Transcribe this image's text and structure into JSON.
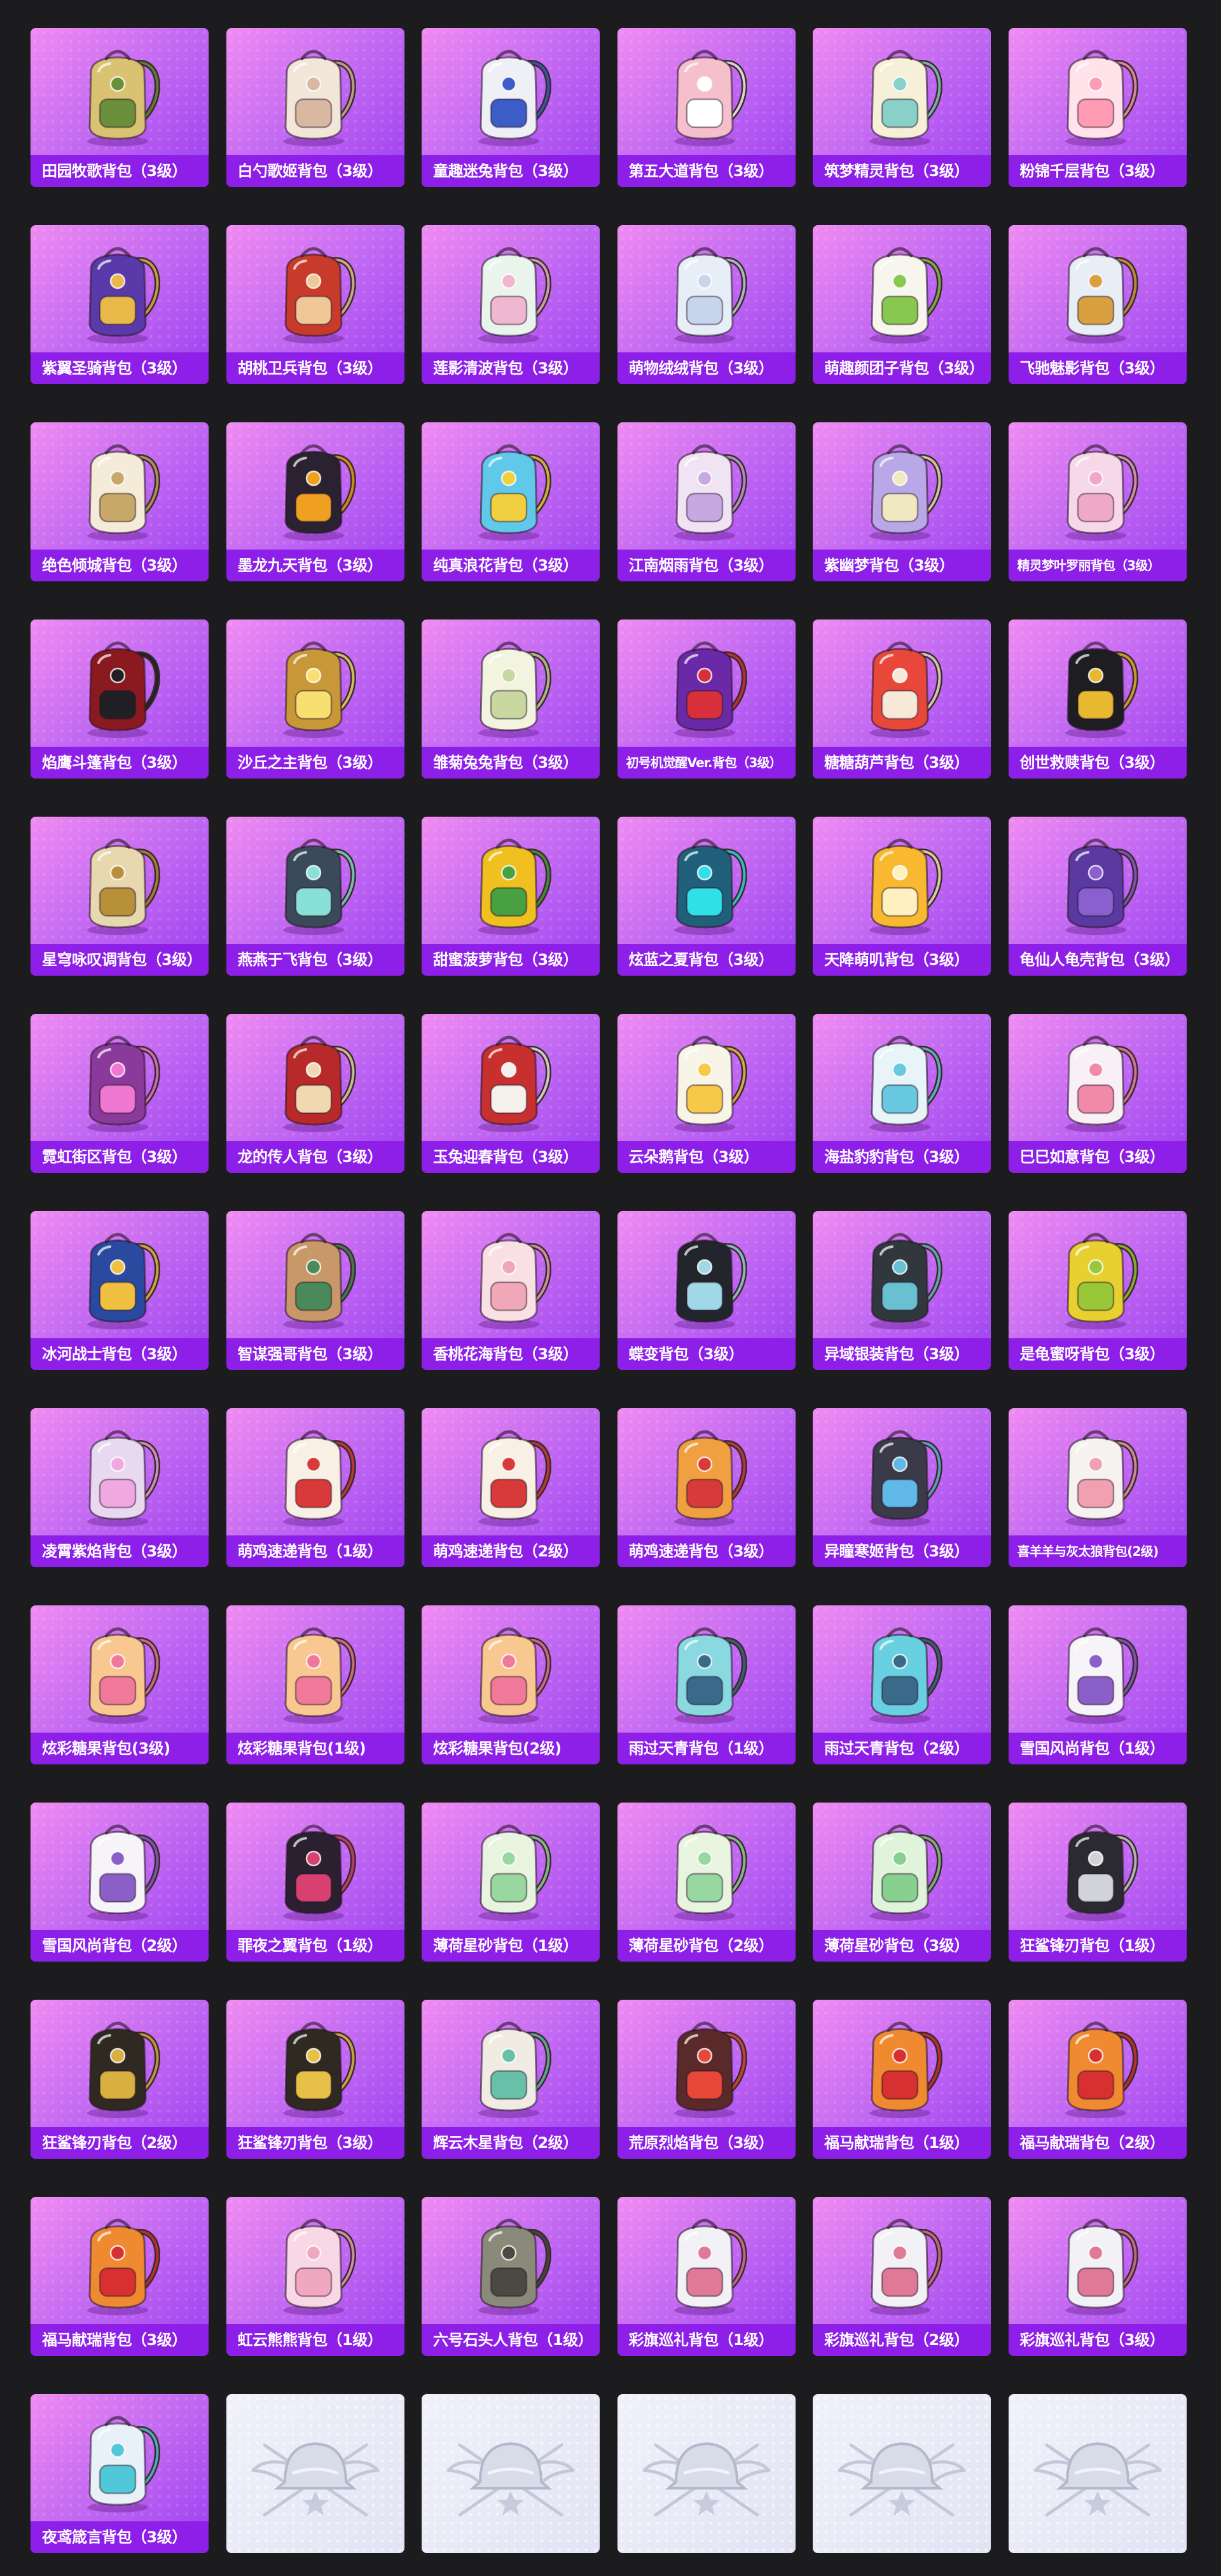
{
  "items": [
    {
      "label": "田园牧歌背包（3级）",
      "icon": "woven-basket-backpack",
      "color": "#d9c271",
      "accent": "#6a8f3a"
    },
    {
      "label": "白勺歌姬背包（3级）",
      "icon": "cream-plush-backpack",
      "color": "#f2e6d8",
      "accent": "#d8b8a0"
    },
    {
      "label": "童趣迷兔背包（3级）",
      "icon": "bunny-patchwork-backpack",
      "color": "#eef0f6",
      "accent": "#3c5cc8"
    },
    {
      "label": "第五大道背包（3级）",
      "icon": "pink-leather-backpack",
      "color": "#f5c0cc",
      "accent": "#ffffff"
    },
    {
      "label": "筑梦精灵背包（3级）",
      "icon": "fairy-winged-backpack",
      "color": "#f6f0d8",
      "accent": "#88d0c8"
    },
    {
      "label": "粉锦千层背包（3级）",
      "icon": "pink-ruffle-backpack",
      "color": "#ffe2ea",
      "accent": "#ff9cb4"
    },
    {
      "label": "紫翼圣骑背包（3级）",
      "icon": "armored-knight-backpack",
      "color": "#5a3aa8",
      "accent": "#e8b848"
    },
    {
      "label": "胡桃卫兵背包（3级）",
      "icon": "nutcracker-backpack",
      "color": "#c83a2a",
      "accent": "#f0c898"
    },
    {
      "label": "莲影清波背包（3级）",
      "icon": "lotus-backpack",
      "color": "#e8f4ec",
      "accent": "#f0b8d0"
    },
    {
      "label": "萌物绒绒背包（3级）",
      "icon": "fluffy-plush-backpack",
      "color": "#e8eef8",
      "accent": "#c8d4ec"
    },
    {
      "label": "萌趣颜团子背包（3级）",
      "icon": "dumpling-mascot-backpack",
      "color": "#f6f6ee",
      "accent": "#88c850"
    },
    {
      "label": "飞驰魅影背包（3级）",
      "icon": "racer-backpack",
      "color": "#e8eef6",
      "accent": "#d8a040"
    },
    {
      "label": "绝色倾城背包（3级）",
      "icon": "round-ornate-backpack",
      "color": "#f4ecd8",
      "accent": "#c8a868"
    },
    {
      "label": "墨龙九天背包（3级）",
      "icon": "black-dragon-backpack",
      "color": "#2a2230",
      "accent": "#f0a020"
    },
    {
      "label": "纯真浪花背包（3级）",
      "icon": "drink-cup-backpack",
      "color": "#60c8e8",
      "accent": "#f0d040"
    },
    {
      "label": "江南烟雨背包（3级）",
      "icon": "flower-bloom-backpack",
      "color": "#f0e4f4",
      "accent": "#c8a8e0"
    },
    {
      "label": "紫幽梦背包（3级）",
      "icon": "purple-petal-backpack",
      "color": "#b8a8e8",
      "accent": "#f0e8c0"
    },
    {
      "label": "精灵梦叶罗丽背包（3级）",
      "icon": "heart-fairy-backpack",
      "color": "#f6d8e8",
      "accent": "#f0a8c8"
    },
    {
      "label": "焰鹰斗篷背包（3级）",
      "icon": "red-black-tactical-backpack",
      "color": "#8a1a20",
      "accent": "#202024"
    },
    {
      "label": "沙丘之主背包（3级）",
      "icon": "golden-scroll-backpack",
      "color": "#c89838",
      "accent": "#f8e070"
    },
    {
      "label": "雏菊兔兔背包（3级）",
      "icon": "daisy-bunny-backpack",
      "color": "#f2f4e0",
      "accent": "#c8d8a0"
    },
    {
      "label": "初号机觉醒Ver.背包（3级）",
      "icon": "purple-shield-backpack",
      "color": "#6a2aa8",
      "accent": "#d8303a"
    },
    {
      "label": "糖糖葫芦背包（3级）",
      "icon": "candied-haw-backpack",
      "color": "#e8483a",
      "accent": "#f8e8d8"
    },
    {
      "label": "创世救赎背包（3级）",
      "icon": "black-gold-armor-backpack",
      "color": "#1e1e22",
      "accent": "#e8b830"
    },
    {
      "label": "星穹咏叹调背包（3级）",
      "icon": "gold-bunny-ear-backpack",
      "color": "#e8d8b0",
      "accent": "#b8903a"
    },
    {
      "label": "燕燕于飞背包（3级）",
      "icon": "swallow-ornament-backpack",
      "color": "#3a4a5a",
      "accent": "#88e0d8"
    },
    {
      "label": "甜蜜菠萝背包（3级）",
      "icon": "pineapple-backpack",
      "color": "#f0c020",
      "accent": "#48a040"
    },
    {
      "label": "炫蓝之夏背包（3级）",
      "icon": "teal-camo-backpack",
      "color": "#20607a",
      "accent": "#30e0e8"
    },
    {
      "label": "天降萌叽背包（3级）",
      "icon": "yellow-bear-backpack",
      "color": "#f8b830",
      "accent": "#fff0c0"
    },
    {
      "label": "龟仙人龟壳背包（3级）",
      "icon": "turtle-shell-backpack",
      "color": "#5a3aa0",
      "accent": "#8a60d0"
    },
    {
      "label": "霓虹街区背包（3级）",
      "icon": "neon-sequin-backpack",
      "color": "#8a3a9a",
      "accent": "#f078d0"
    },
    {
      "label": "龙的传人背包（3级）",
      "icon": "red-dragon-pack",
      "color": "#b82a2a",
      "accent": "#f0d8b0"
    },
    {
      "label": "玉兔迎春背包（3级）",
      "icon": "red-white-hiking-backpack",
      "color": "#c83030",
      "accent": "#f4f0ec"
    },
    {
      "label": "云朵鹅背包（3级）",
      "icon": "cloud-goose-backpack",
      "color": "#f8f4e8",
      "accent": "#f8c848"
    },
    {
      "label": "海盐豹豹背包（3级）",
      "icon": "sea-salt-leopard-backpack",
      "color": "#e8f4f8",
      "accent": "#68c8e0"
    },
    {
      "label": "巳巳如意背包（3级）",
      "icon": "snake-bun-backpack",
      "color": "#f8f0f4",
      "accent": "#f08aa8"
    },
    {
      "label": "冰河战士背包（3级）",
      "icon": "navy-blue-backpack",
      "color": "#2a4aa0",
      "accent": "#f0c040"
    },
    {
      "label": "智谋强哥背包（3级）",
      "icon": "bear-mascot-backpack",
      "color": "#c89868",
      "accent": "#4a8a5a"
    },
    {
      "label": "香桃花海背包（3级）",
      "icon": "peach-blossom-backpack",
      "color": "#f8e0e4",
      "accent": "#f0a8b8"
    },
    {
      "label": "蝶变背包（3级）",
      "icon": "butterfly-black-backpack",
      "color": "#22262c",
      "accent": "#a0d8e8"
    },
    {
      "label": "异域银装背包（3级）",
      "icon": "silver-mech-backpack",
      "color": "#30383e",
      "accent": "#68c0d0"
    },
    {
      "label": "是龟蜜呀背包（3级）",
      "icon": "yellow-turtle-backpack",
      "color": "#e8d030",
      "accent": "#98c838"
    },
    {
      "label": "凌霄紫焰背包（3级）",
      "icon": "violet-flame-backpack",
      "color": "#e8d8f0",
      "accent": "#f0a8e0"
    },
    {
      "label": "萌鸡速递背包（1级）",
      "icon": "chick-delivery-backpack",
      "color": "#f8f0e4",
      "accent": "#d83a3a"
    },
    {
      "label": "萌鸡速递背包（2级）",
      "icon": "chick-delivery-backpack",
      "color": "#f8f0e4",
      "accent": "#d83a3a"
    },
    {
      "label": "萌鸡速递背包（3级）",
      "icon": "chick-delivery-backpack",
      "color": "#f0a040",
      "accent": "#d83a3a"
    },
    {
      "label": "异瞳寒姬背包（3级）",
      "icon": "heterochromia-bunny-backpack",
      "color": "#3a3a48",
      "accent": "#60b8e8"
    },
    {
      "label": "喜羊羊与灰太狼背包(2级)",
      "icon": "sheep-wolf-backpack",
      "color": "#f6f2f0",
      "accent": "#f0a0b0"
    },
    {
      "label": "炫彩糖果背包(3级)",
      "icon": "donut-candy-backpack",
      "color": "#f8c890",
      "accent": "#f07898"
    },
    {
      "label": "炫彩糖果背包(1级)",
      "icon": "donut-candy-backpack",
      "color": "#f8c890",
      "accent": "#f07898"
    },
    {
      "label": "炫彩糖果背包(2级)",
      "icon": "donut-candy-backpack",
      "color": "#f8c890",
      "accent": "#f07898"
    },
    {
      "label": "雨过天青背包（1级）",
      "icon": "teardrop-charm-backpack",
      "color": "#8ad8e0",
      "accent": "#3a6a8a"
    },
    {
      "label": "雨过天青背包（2级）",
      "icon": "teardrop-charm-backpack",
      "color": "#68d0e0",
      "accent": "#3a6a8a"
    },
    {
      "label": "雪国风尚背包（1级）",
      "icon": "snow-bunny-backpack",
      "color": "#f6f4f8",
      "accent": "#8a60c8"
    },
    {
      "label": "雪国风尚背包（2级）",
      "icon": "snow-bunny-backpack",
      "color": "#f6f4f8",
      "accent": "#8a60c8"
    },
    {
      "label": "罪夜之翼背包（1级）",
      "icon": "bat-wing-backpack",
      "color": "#2a2030",
      "accent": "#d84070"
    },
    {
      "label": "薄荷星砂背包（1级）",
      "icon": "mint-stardust-backpack",
      "color": "#e8f4e0",
      "accent": "#98d8a0"
    },
    {
      "label": "薄荷星砂背包（2级）",
      "icon": "mint-stardust-backpack",
      "color": "#e8f4e0",
      "accent": "#98d8a0"
    },
    {
      "label": "薄荷星砂背包（3级）",
      "icon": "mint-stardust-backpack",
      "color": "#e0f4dc",
      "accent": "#88d090"
    },
    {
      "label": "狂鲨锋刃背包（1级）",
      "icon": "shark-fin-backpack",
      "color": "#2a2a30",
      "accent": "#d0d4d8"
    },
    {
      "label": "狂鲨锋刃背包（2级）",
      "icon": "shark-fin-backpack",
      "color": "#2e2a22",
      "accent": "#d8b040"
    },
    {
      "label": "狂鲨锋刃背包（3级）",
      "icon": "shark-fin-backpack",
      "color": "#2e2a22",
      "accent": "#e8c048"
    },
    {
      "label": "辉云木星背包（2级）",
      "icon": "jupiter-orb-backpack",
      "color": "#f0ece4",
      "accent": "#68c0a8"
    },
    {
      "label": "荒原烈焰背包（3级）",
      "icon": "wasteland-flame-backpack",
      "color": "#5a2a2a",
      "accent": "#e84838"
    },
    {
      "label": "福马献瑞背包（1级）",
      "icon": "lucky-horse-backpack",
      "color": "#f08a30",
      "accent": "#d83030"
    },
    {
      "label": "福马献瑞背包（2级）",
      "icon": "lucky-horse-backpack",
      "color": "#f08a30",
      "accent": "#d83030"
    },
    {
      "label": "福马献瑞背包（3级）",
      "icon": "lucky-horse-backpack",
      "color": "#f08a30",
      "accent": "#d83030"
    },
    {
      "label": "虹云熊熊背包（1级）",
      "icon": "rainbow-cloud-bear-backpack",
      "color": "#f8d8e4",
      "accent": "#f0a8c0"
    },
    {
      "label": "六号石头人背包（1级）",
      "icon": "stone-golem-backpack",
      "color": "#8a8a7a",
      "accent": "#4a4a42"
    },
    {
      "label": "彩旗巡礼背包（1级）",
      "icon": "parade-flag-backpack",
      "color": "#f2f2f6",
      "accent": "#e07898"
    },
    {
      "label": "彩旗巡礼背包（2级）",
      "icon": "parade-flag-backpack",
      "color": "#f2f2f6",
      "accent": "#e07898"
    },
    {
      "label": "彩旗巡礼背包（3级）",
      "icon": "parade-flag-backpack",
      "color": "#f2f2f6",
      "accent": "#e07898"
    },
    {
      "label": "夜鸢箴言背包（3级）",
      "icon": "night-kite-backpack",
      "color": "#e8f0f8",
      "accent": "#50c8d8"
    },
    {
      "empty": true,
      "icon": "helmet-crest-emblem"
    },
    {
      "empty": true,
      "icon": "helmet-crest-emblem"
    },
    {
      "empty": true,
      "icon": "helmet-crest-emblem"
    },
    {
      "empty": true,
      "icon": "helmet-crest-emblem"
    },
    {
      "empty": true,
      "icon": "helmet-crest-emblem"
    }
  ]
}
